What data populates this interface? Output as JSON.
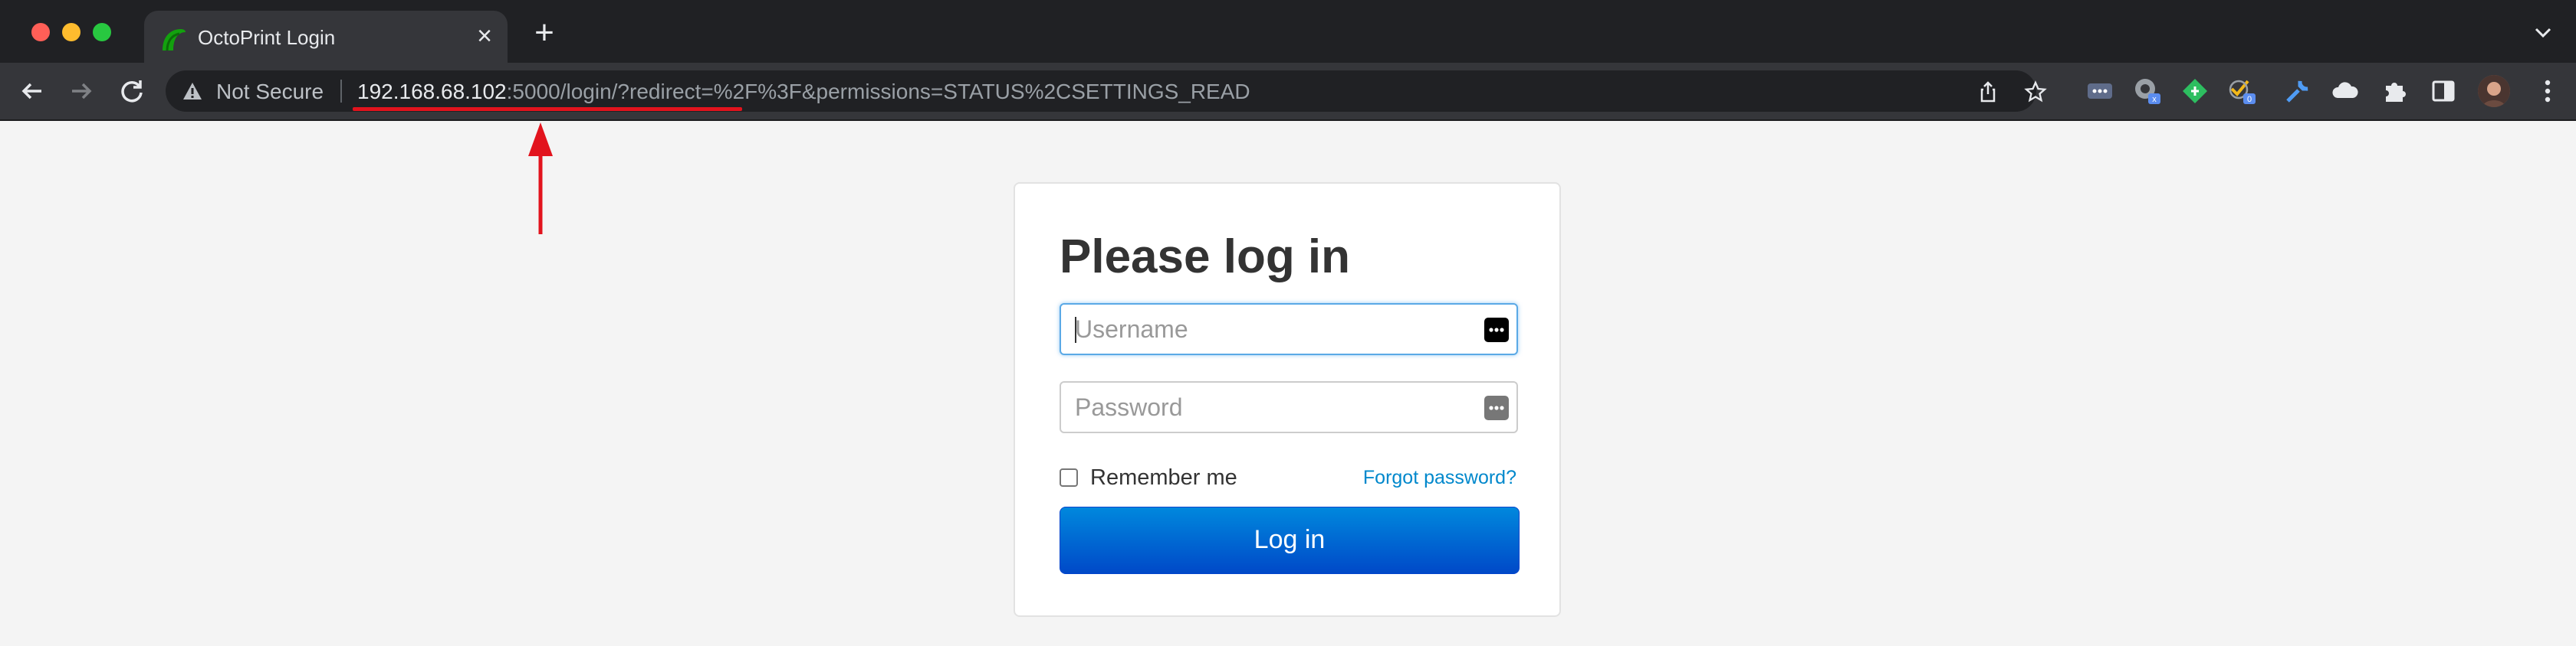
{
  "browser": {
    "tab_title": "OctoPrint Login",
    "tab_close": "×",
    "new_tab": "+",
    "security_label": "Not Secure",
    "url_host": "192.168.68.102",
    "url_rest": ":5000/login/?redirect=%2F%3F&permissions=STATUS%2CSETTINGS_READ",
    "extension_badges": [
      "x",
      "0"
    ]
  },
  "login": {
    "heading": "Please log in",
    "username_placeholder": "Username",
    "password_placeholder": "Password",
    "remember_label": "Remember me",
    "forgot_link": "Forgot password?",
    "submit_label": "Log in"
  },
  "colors": {
    "annotation": "#e2131d",
    "button": "#0055cc",
    "link": "#0088cc",
    "page_bg": "#f4f4f4"
  }
}
